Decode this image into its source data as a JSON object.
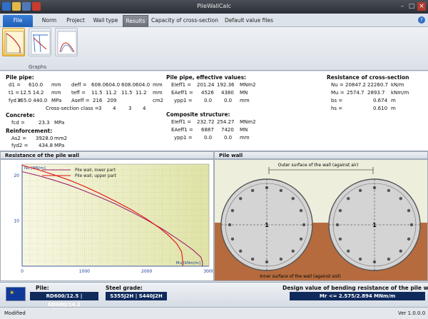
{
  "window": {
    "title": "PileWallCalc"
  },
  "tabs": [
    "File",
    "Norm",
    "Project",
    "Wall type",
    "Results",
    "Capacity of cross-section",
    "Default value files"
  ],
  "ribbon": {
    "group_label": "Graphs",
    "buttons": [
      "bending-capacity-graph",
      "stress-graph",
      "interaction-graph"
    ]
  },
  "pile_pipe": {
    "heading": "Pile pipe:",
    "rows": [
      {
        "sym": "d1 =",
        "v1": "610.0",
        "u1": "mm",
        "sym2": "deff =",
        "a": "608.0",
        "b": "604.0",
        "c": "608.0",
        "d": "604.0",
        "u2": "mm"
      },
      {
        "sym": "t1 =",
        "v1": "12.5  14.2",
        "u1": "mm",
        "sym2": "teff =",
        "a": "11.5",
        "b": "11.2",
        "c": "11.5",
        "d": "11.2",
        "u2": "mm"
      },
      {
        "sym": "fyd =",
        "v1": "355.0  440.0",
        "u1": "MPa",
        "sym2": "Aseff =",
        "a": "216",
        "b": "209",
        "c": "",
        "d": "",
        "u2": "cm2"
      }
    ],
    "class_label": "Cross-section class =",
    "classes": [
      "3",
      "4",
      "3",
      "4"
    ]
  },
  "concrete": {
    "heading": "Concrete:",
    "sym": "fcd =",
    "value": "23.3",
    "unit": "MPa"
  },
  "reinforcement": {
    "heading": "Reinforcement:",
    "rows": [
      {
        "sym": "As2 =",
        "value": "3928.0",
        "unit": "mm2"
      },
      {
        "sym": "fyd2 =",
        "value": "434.8",
        "unit": "MPa"
      }
    ]
  },
  "effective": {
    "heading": "Pile pipe, effective values:",
    "rows": [
      {
        "sym": "EIeff1 =",
        "a": "201.24",
        "b": "192.36",
        "unit": "MNm2"
      },
      {
        "sym": "EAeff1 =",
        "a": "4526",
        "b": "4380",
        "unit": "MN"
      },
      {
        "sym": "ypp1 =",
        "a": "0.0",
        "b": "0.0",
        "unit": "mm"
      }
    ]
  },
  "composite": {
    "heading": "Composite structure:",
    "rows": [
      {
        "sym": "EIeff1 =",
        "a": "232.72",
        "b": "254.27",
        "unit": "MNm2"
      },
      {
        "sym": "EAeff1 =",
        "a": "6887",
        "b": "7420",
        "unit": "MN"
      },
      {
        "sym": "ypp1 =",
        "a": "0.0",
        "b": "0.0",
        "unit": "mm"
      }
    ]
  },
  "resistance": {
    "heading": "Resistance of cross-section",
    "rows": [
      {
        "sym": "Nu =",
        "a": "20847.2",
        "b": "22260.7",
        "unit": "kN/m"
      },
      {
        "sym": "Mu =",
        "a": "2574.7",
        "b": "2893.7",
        "unit": "kNm/m"
      },
      {
        "sym": "bs =",
        "a": "",
        "b": "0.674",
        "unit": "m"
      },
      {
        "sym": "hs =",
        "a": "",
        "b": "0.610",
        "unit": "m"
      }
    ]
  },
  "sections": {
    "chart": "Resistance of the pile wall",
    "wall": "Pile wall"
  },
  "chart_data": {
    "type": "line",
    "xlabel": "Mu [kNm/m]",
    "ylabel": "Nu [MN/m]",
    "xlim": [
      0,
      3000
    ],
    "ylim": [
      0,
      22.5
    ],
    "xticks": [
      0,
      1000,
      2000,
      3000
    ],
    "yticks": [
      10,
      20
    ],
    "series": [
      {
        "name": "Pile wall, lower part",
        "color": "#a0206e",
        "x": [
          0,
          250,
          500,
          750,
          1000,
          1250,
          1500,
          1750,
          2000,
          2250,
          2450,
          2600,
          2750,
          2870,
          2893.7,
          2895,
          2893.7
        ],
        "y": [
          20.85,
          20.0,
          19.0,
          17.9,
          16.6,
          15.2,
          13.7,
          12.0,
          10.2,
          8.2,
          6.4,
          5.0,
          3.5,
          2.0,
          1.0,
          0.5,
          0
        ]
      },
      {
        "name": "Pile wall, upper part",
        "color": "#e01010",
        "x": [
          0,
          250,
          500,
          750,
          1000,
          1250,
          1500,
          1750,
          2000,
          2200,
          2350,
          2480,
          2560,
          2574.7,
          2576,
          2574.7
        ],
        "y": [
          22.26,
          21.3,
          20.2,
          19.0,
          17.6,
          16.0,
          14.3,
          12.5,
          10.4,
          8.5,
          6.8,
          5.0,
          3.2,
          1.5,
          0.6,
          0
        ]
      }
    ]
  },
  "wall": {
    "top_label": "Outer surface of the wall (against air)",
    "bottom_label": "Inner surface of the wall (against soil)",
    "pile_labels": [
      "1",
      "1"
    ]
  },
  "bottom": {
    "pile_label": "Pile:",
    "pile_value": "RD600/12.5 | RD600/14.2",
    "steel_label": "Steel grade:",
    "steel_value": "S355J2H | S440J2H",
    "design_label": "Design value of bending resistance of the pile wall:",
    "design_value": "Mr <= 2.575/2.894 MNm/m"
  },
  "status": {
    "left": "Modified",
    "right": "Ver 1.0.0.0"
  }
}
